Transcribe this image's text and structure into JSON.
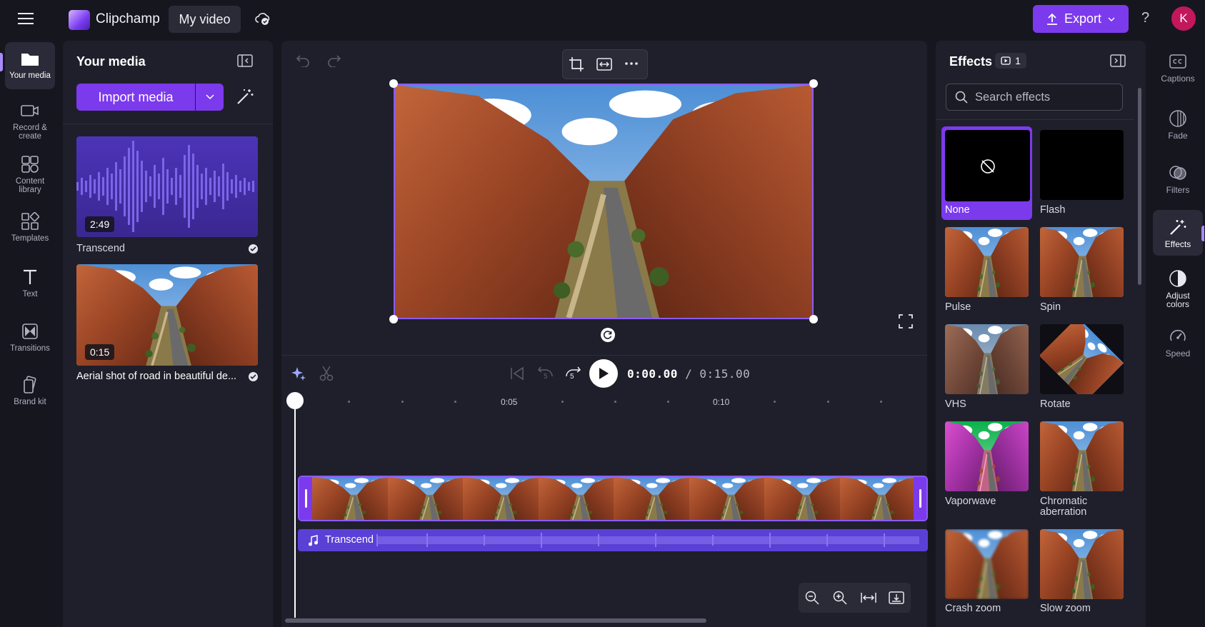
{
  "header": {
    "app_name": "Clipchamp",
    "project_name": "My video",
    "export_label": "Export",
    "help_label": "?",
    "avatar_initial": "K"
  },
  "left_rail": [
    {
      "label": "Your media",
      "icon": "folder-icon",
      "active": true
    },
    {
      "label": "Record & create",
      "icon": "camera-icon"
    },
    {
      "label": "Content library",
      "icon": "content-library-icon"
    },
    {
      "label": "Templates",
      "icon": "templates-icon"
    },
    {
      "label": "Text",
      "icon": "text-icon"
    },
    {
      "label": "Transitions",
      "icon": "transitions-icon"
    },
    {
      "label": "Brand kit",
      "icon": "brand-kit-icon"
    }
  ],
  "media_panel": {
    "title": "Your media",
    "import_label": "Import media",
    "items": [
      {
        "name": "Transcend",
        "duration": "2:49",
        "type": "audio"
      },
      {
        "name": "Aerial shot of road in beautiful de...",
        "duration": "0:15",
        "type": "video"
      }
    ]
  },
  "timeline": {
    "current_time": "0:00.00",
    "total_time": "/ 0:15.00",
    "ruler_labels": [
      "0:05",
      "0:10"
    ],
    "skip_back_seconds": "5",
    "skip_forward_seconds": "5",
    "audio_track_label": "Transcend"
  },
  "effects_panel": {
    "title": "Effects",
    "applied_count": "1",
    "search_placeholder": "Search effects",
    "effects": [
      {
        "name": "None",
        "selected": true
      },
      {
        "name": "Flash"
      },
      {
        "name": "Pulse"
      },
      {
        "name": "Spin"
      },
      {
        "name": "VHS"
      },
      {
        "name": "Rotate"
      },
      {
        "name": "Vaporwave"
      },
      {
        "name": "Chromatic aberration"
      },
      {
        "name": "Crash zoom"
      },
      {
        "name": "Slow zoom"
      }
    ]
  },
  "right_rail": [
    {
      "label": "Captions",
      "icon": "captions-icon"
    },
    {
      "label": "Fade",
      "icon": "fade-icon"
    },
    {
      "label": "Filters",
      "icon": "filters-icon"
    },
    {
      "label": "Effects",
      "icon": "magic-wand-icon",
      "active": true
    },
    {
      "label": "Adjust colors",
      "icon": "adjust-colors-icon"
    },
    {
      "label": "Speed",
      "icon": "speedometer-icon"
    }
  ],
  "colors": {
    "accent": "#7c3aed",
    "background": "#16161f",
    "panel": "#1f1f2b",
    "audio_track": "#5b40d6"
  }
}
